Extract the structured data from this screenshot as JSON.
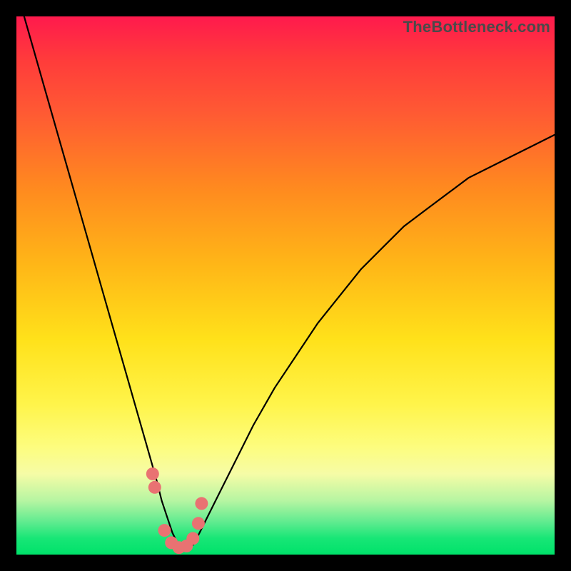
{
  "watermark": "TheBottleneck.com",
  "chart_data": {
    "type": "line",
    "title": "",
    "xlabel": "",
    "ylabel": "",
    "xlim": [
      0,
      100
    ],
    "ylim": [
      0,
      100
    ],
    "series": [
      {
        "name": "bottleneck-curve",
        "x": [
          0,
          2,
          4,
          6,
          8,
          10,
          12,
          14,
          16,
          18,
          20,
          22,
          24,
          26,
          27,
          28,
          29,
          30,
          31,
          32,
          33,
          34,
          36,
          38,
          40,
          44,
          48,
          52,
          56,
          60,
          64,
          68,
          72,
          76,
          80,
          84,
          88,
          92,
          96,
          100
        ],
        "y": [
          105,
          98,
          91,
          84,
          77,
          70,
          63,
          56,
          49,
          42,
          35,
          28,
          21,
          14,
          10,
          7,
          4,
          2,
          1,
          1,
          2,
          4,
          8,
          12,
          16,
          24,
          31,
          37,
          43,
          48,
          53,
          57,
          61,
          64,
          67,
          70,
          72,
          74,
          76,
          78
        ]
      }
    ],
    "markers": {
      "name": "highlight-points",
      "x": [
        25.3,
        25.7,
        27.5,
        28.8,
        30.2,
        31.6,
        32.8,
        33.8,
        34.4
      ],
      "y": [
        15.0,
        12.5,
        4.5,
        2.2,
        1.3,
        1.6,
        3.0,
        5.8,
        9.5
      ],
      "color": "#e97272",
      "size": 9
    },
    "background_gradient": {
      "top": "#ff1a4d",
      "mid": "#fff44a",
      "bottom": "#00e26a"
    }
  }
}
